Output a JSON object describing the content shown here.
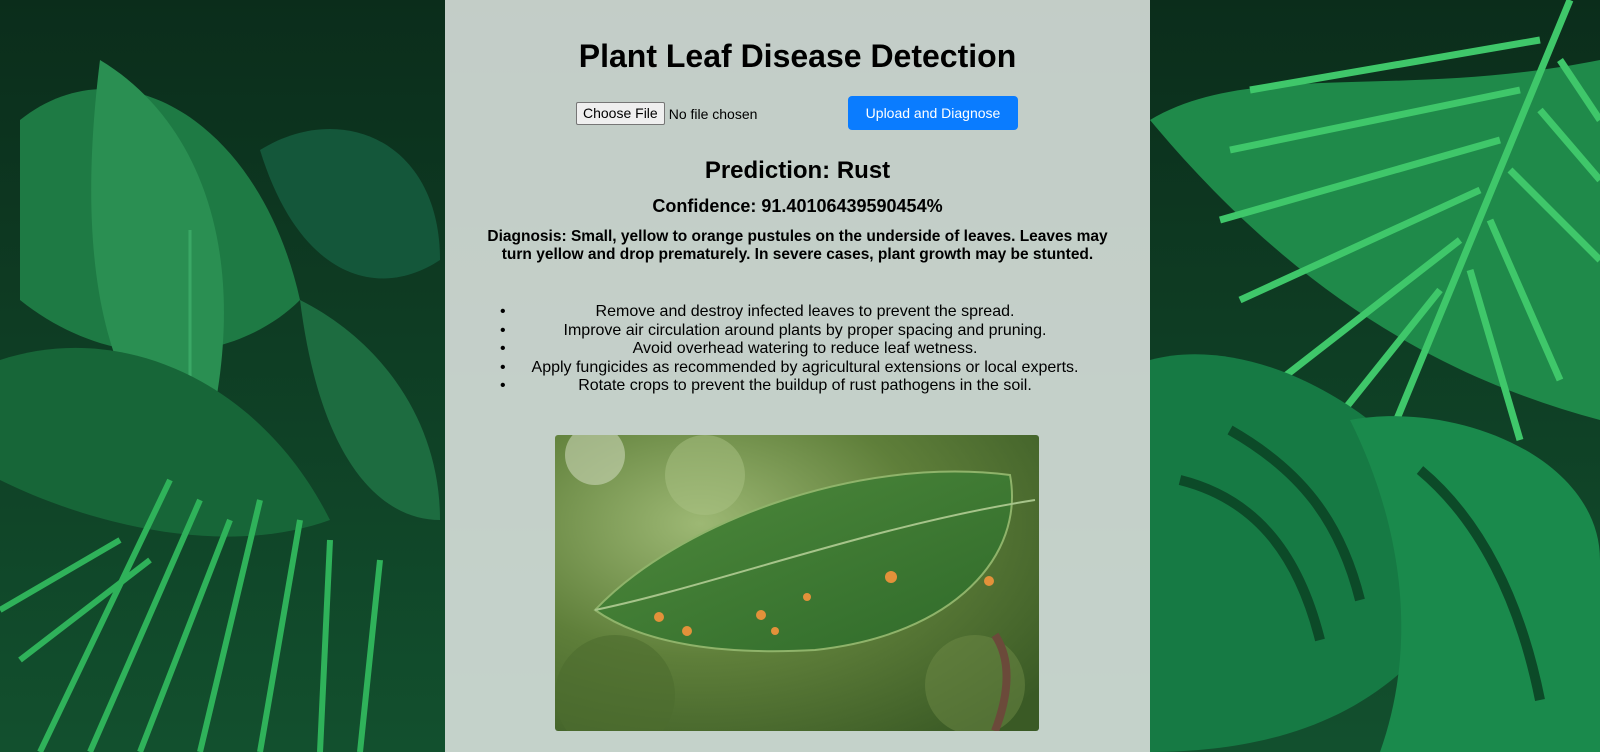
{
  "page": {
    "title": "Plant Leaf Disease Detection"
  },
  "upload": {
    "choose_label": "Choose File",
    "file_status": "No file chosen",
    "submit_label": "Upload and Diagnose"
  },
  "result": {
    "prediction": "Prediction: Rust",
    "confidence": "Confidence: 91.40106439590454%",
    "diagnosis": "Diagnosis: Small, yellow to orange pustules on the underside of leaves. Leaves may turn yellow and drop prematurely. In severe cases, plant growth may be stunted.",
    "remedies": [
      "Remove and destroy infected leaves to prevent the spread.",
      "Improve air circulation around plants by proper spacing and pruning.",
      "Avoid overhead watering to reduce leaf wetness.",
      "Apply fungicides as recommended by agricultural extensions or local experts.",
      "Rotate crops to prevent the buildup of rust pathogens in the soil."
    ]
  },
  "colors": {
    "accent": "#0a7cff",
    "panel": "#e2e8e4",
    "background_leaf": "#0d3a22"
  }
}
